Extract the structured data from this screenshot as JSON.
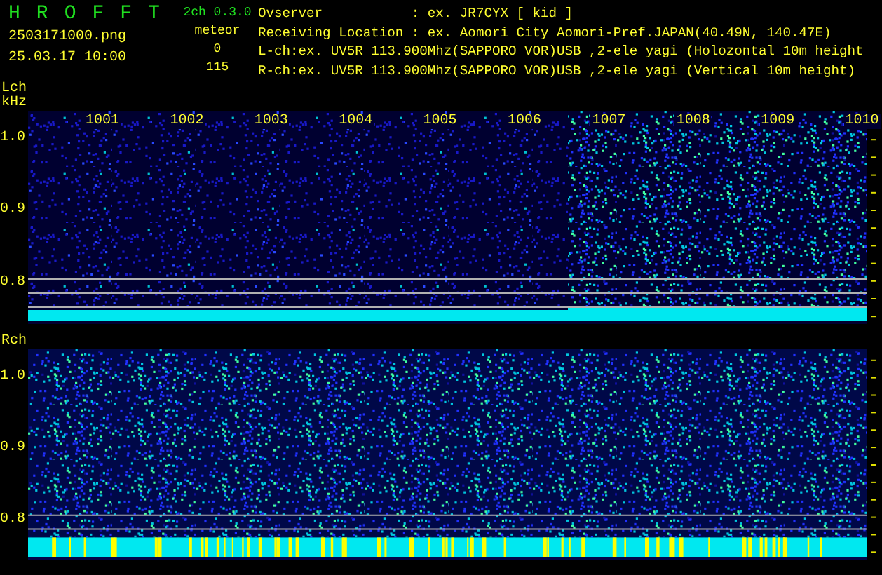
{
  "app": {
    "title_letters": [
      "H",
      "R",
      "O",
      "F",
      "F",
      "T"
    ],
    "version": "2ch 0.3.0",
    "file": "2503171000.png",
    "datetime": "25.03.17 10:00"
  },
  "meteor": {
    "label": "meteor",
    "counts": [
      "0",
      "115"
    ]
  },
  "info_lines": [
    "Ovserver           : ex. JR7CYX [ kid ]",
    "Receiving Location : ex. Aomori City Aomori-Pref.JAPAN(40.49N, 140.47E)",
    "L-ch:ex. UV5R 113.900Mhz(SAPPORO VOR)USB ,2-ele yagi (Holozontal 10m height",
    "R-ch:ex. UV5R 113.900Mhz(SAPPORO VOR)USB ,2-ele yagi (Vertical 10m height)"
  ],
  "channels": [
    {
      "label": "Lch",
      "unit": "kHz",
      "time_labels": [
        "1001",
        "1002",
        "1003",
        "1004",
        "1005",
        "1006",
        "1007",
        "1008",
        "1009",
        "1010"
      ],
      "y_labels": [
        "1.0",
        "0.9",
        "0.8"
      ]
    },
    {
      "label": "Rch",
      "y_labels": [
        "1.0",
        "0.9",
        "0.8"
      ]
    }
  ]
}
